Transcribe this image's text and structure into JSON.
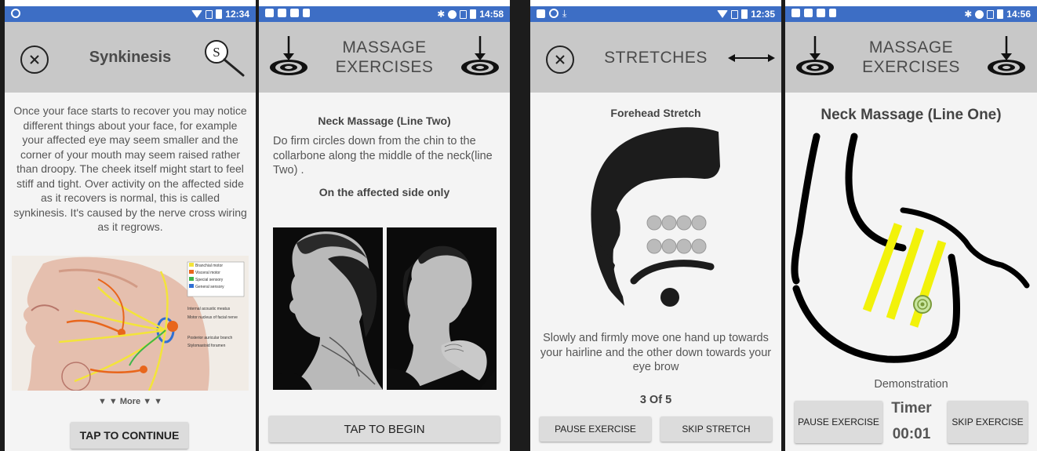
{
  "colors": {
    "status_bar": "#3d6ec5",
    "title_bar": "#c8c8c8",
    "button": "#dcdcdc",
    "stripe_yellow": "#f2f20a"
  },
  "screens": [
    {
      "status": {
        "time": "12:34",
        "left_icons": [
          "record-icon"
        ],
        "right_icons": [
          "wifi-icon",
          "no-sim-icon",
          "battery-icon"
        ]
      },
      "title": "Synkinesis",
      "left_icon": "close-icon",
      "right_icon": "search-s-icon",
      "description": "Once your face starts to recover you may notice different things about your face, for example your affected eye may seem smaller and the corner of your mouth may seem raised rather than droopy. The cheek itself might start to feel stiff and tight. Over activity on the affected side as it recovers is normal, this is called synkinesis. It's caused by the nerve cross wiring as it regrows.",
      "diagram_legend": [
        "Branchial motor",
        "Visceral motor",
        "Special sensory",
        "General sensory"
      ],
      "legend_colors": [
        "#f3e43a",
        "#e8661c",
        "#3fb64a",
        "#2f6fd3"
      ],
      "diagram_labels": [
        "Internal acoustic meatus",
        "Motor nucleus of facial nerve",
        "Posterior auricular branch",
        "Stylomastoid foramen"
      ],
      "more_label": "▼ ▼ More ▼ ▼",
      "button": "TAP TO CONTINUE"
    },
    {
      "status": {
        "time": "14:58",
        "left_icons": [
          "image-icon",
          "n-icon",
          "card-icon",
          "play-icon"
        ],
        "right_icons": [
          "bluetooth-icon",
          "dnd-icon",
          "no-sim-icon",
          "battery-icon"
        ]
      },
      "title": "MASSAGE EXERCISES",
      "left_icon": "target-down-icon",
      "right_icon": "target-down-icon",
      "exercise_title": "Neck Massage (Line Two)",
      "instructions": "Do firm circles down from the chin to the collarbone along the middle of the neck(line Two) .",
      "note": "On the affected side only",
      "button": "TAP TO BEGIN"
    },
    {
      "status": {
        "time": "12:35",
        "left_icons": [
          "image-icon",
          "record-icon",
          "download-icon"
        ],
        "right_icons": [
          "wifi-icon",
          "no-sim-icon",
          "battery-icon"
        ]
      },
      "title": "STRETCHES",
      "left_icon": "close-icon",
      "right_icon": "double-arrow-icon",
      "exercise_title": "Forehead Stretch",
      "instructions": "Slowly and firmly move one hand up towards your hairline and the other down towards your eye brow",
      "progress": "3 Of 5",
      "pause_button": "PAUSE EXERCISE",
      "skip_button": "SKIP STRETCH"
    },
    {
      "status": {
        "time": "14:56",
        "left_icons": [
          "image-icon",
          "n-icon",
          "card-icon",
          "play-icon"
        ],
        "right_icons": [
          "bluetooth-icon",
          "dnd-icon",
          "no-sim-icon",
          "battery-icon"
        ]
      },
      "title": "MASSAGE EXERCISES",
      "left_icon": "target-down-icon",
      "right_icon": "target-down-icon",
      "exercise_title": "Neck Massage (Line One)",
      "demo_label": "Demonstration",
      "timer_label": "Timer",
      "timer_value": "00:01",
      "pause_button": "PAUSE EXERCISE",
      "skip_button": "SKIP EXERCISE"
    }
  ]
}
